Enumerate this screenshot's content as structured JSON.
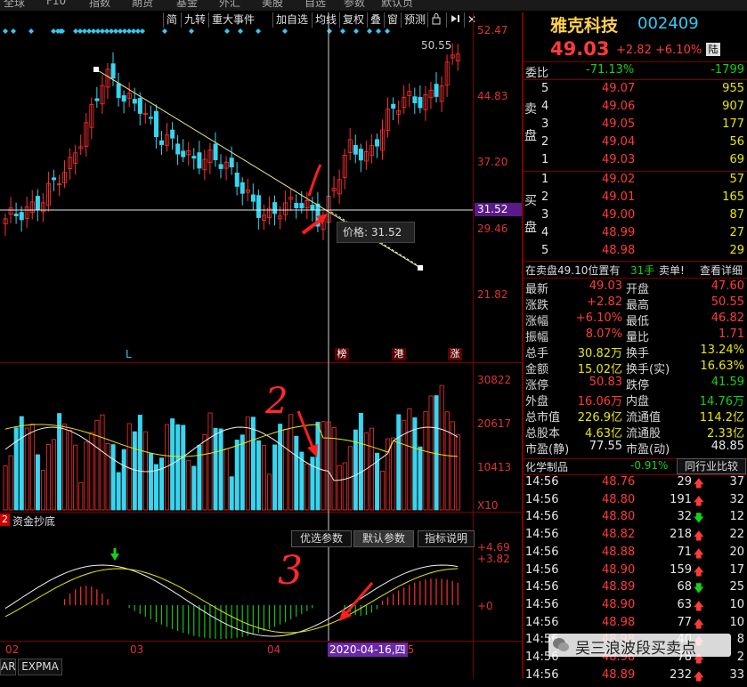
{
  "top_menu": [
    "全球",
    "F10",
    "指数",
    "期货",
    "基金",
    "外汇",
    "美股",
    "自选",
    "参数",
    "默认页"
  ],
  "toolbar": {
    "items": [
      "简",
      "九转",
      "重大事件",
      "加自选",
      "均线",
      "复权",
      "叠",
      "窗",
      "预测"
    ],
    "lock_icon": "lock-icon",
    "arrow_icon": "arrow-right-icon"
  },
  "price_axis": [
    "52.47",
    "44.83",
    "37.20",
    "31.52",
    "29.46",
    "21.82"
  ],
  "price_hover_label": "31.52",
  "price_tooltip": "价格: 31.52",
  "high_marker": "50.55",
  "event_markers": [
    "L",
    "榜",
    "港",
    "涨"
  ],
  "volume_axis": [
    "30822",
    "20617",
    "10413"
  ],
  "volume_unit": "X10",
  "volume_indicator": {
    "badge": "2",
    "name": "资金抄底"
  },
  "indicator_tabs": [
    "优选参数",
    "默认参数",
    "指标说明"
  ],
  "macd_axis": [
    "+4.69",
    "+3.82",
    "+0"
  ],
  "x_axis": [
    "02",
    "03",
    "04",
    "05"
  ],
  "cursor_date": "2020-04-16,四",
  "bottom_tabs": [
    "AR",
    "EXPMA"
  ],
  "annotations": [
    "2",
    "3"
  ],
  "stock": {
    "name": "雅克科技",
    "code": "002409",
    "price": "49.03",
    "change": "+2.82",
    "change_pct": "+6.10%",
    "tag": "陆"
  },
  "weibi": {
    "label": "委比",
    "pct": "-71.13%",
    "diff": "-1799"
  },
  "sell_label": "卖盘",
  "buy_label": "买盘",
  "asks": [
    {
      "lvl": "5",
      "price": "49.07",
      "vol": "955"
    },
    {
      "lvl": "4",
      "price": "49.06",
      "vol": "907"
    },
    {
      "lvl": "3",
      "price": "49.05",
      "vol": "177"
    },
    {
      "lvl": "2",
      "price": "49.04",
      "vol": "56"
    },
    {
      "lvl": "1",
      "price": "49.03",
      "vol": "69"
    }
  ],
  "bids": [
    {
      "lvl": "1",
      "price": "49.02",
      "vol": "57"
    },
    {
      "lvl": "2",
      "price": "49.01",
      "vol": "165"
    },
    {
      "lvl": "3",
      "price": "49.00",
      "vol": "87"
    },
    {
      "lvl": "4",
      "price": "48.99",
      "vol": "27"
    },
    {
      "lvl": "5",
      "price": "48.98",
      "vol": "29"
    }
  ],
  "sell_note": {
    "text": "在卖盘49.10位置有",
    "qty": "31手",
    "action": "卖单!",
    "link": "查看详细"
  },
  "quote": [
    {
      "l": "最新",
      "v": "49.03",
      "vc": "red",
      "l2": "开盘",
      "v2": "47.60",
      "v2c": "red"
    },
    {
      "l": "涨跌",
      "v": "+2.82",
      "vc": "red",
      "l2": "最高",
      "v2": "50.55",
      "v2c": "red"
    },
    {
      "l": "涨幅",
      "v": "+6.10%",
      "vc": "red",
      "l2": "最低",
      "v2": "46.82",
      "v2c": "red"
    },
    {
      "l": "振幅",
      "v": "8.07%",
      "vc": "red",
      "l2": "量比",
      "v2": "1.71",
      "v2c": "red"
    },
    {
      "l": "总手",
      "v": "30.82万",
      "vc": "yel",
      "l2": "换手",
      "v2": "13.24%",
      "v2c": "yel"
    },
    {
      "l": "金额",
      "v": "15.02亿",
      "vc": "yel",
      "l2": "换手(实)",
      "v2": "16.63%",
      "v2c": "yel"
    },
    {
      "l": "涨停",
      "v": "50.83",
      "vc": "red",
      "l2": "跌停",
      "v2": "41.59",
      "v2c": "grn"
    },
    {
      "l": "外盘",
      "v": "16.06万",
      "vc": "red",
      "l2": "内盘",
      "v2": "14.76万",
      "v2c": "grn"
    },
    {
      "l": "总市值",
      "v": "226.9亿",
      "vc": "yel",
      "l2": "流通值",
      "v2": "114.2亿",
      "v2c": "yel"
    },
    {
      "l": "总股本",
      "v": "4.63亿",
      "vc": "yel",
      "l2": "流通股",
      "v2": "2.33亿",
      "v2c": "yel"
    },
    {
      "l": "市盈(静)",
      "v": "77.55",
      "vc": "wht",
      "l2": "市盈(动)",
      "v2": "48.85",
      "v2c": "wht"
    }
  ],
  "industry": {
    "name": "化学制品",
    "pct": "-0.91%",
    "btn": "同行业比较"
  },
  "ticks": [
    {
      "t": "14:56",
      "p": "48.76",
      "v": "29",
      "d": "up",
      "n": "37"
    },
    {
      "t": "14:56",
      "p": "48.80",
      "v": "191",
      "d": "up",
      "n": "32"
    },
    {
      "t": "14:56",
      "p": "48.80",
      "v": "32",
      "d": "down",
      "n": "12"
    },
    {
      "t": "14:56",
      "p": "48.82",
      "v": "218",
      "d": "up",
      "n": "22"
    },
    {
      "t": "14:56",
      "p": "48.88",
      "v": "71",
      "d": "up",
      "n": "20"
    },
    {
      "t": "14:56",
      "p": "48.90",
      "v": "159",
      "d": "up",
      "n": "17"
    },
    {
      "t": "14:56",
      "p": "48.89",
      "v": "68",
      "d": "down",
      "n": "25"
    },
    {
      "t": "14:56",
      "p": "48.90",
      "v": "63",
      "d": "up",
      "n": "10"
    },
    {
      "t": "14:56",
      "p": "48.98",
      "v": "77",
      "d": "up",
      "n": "10"
    },
    {
      "t": "14:56",
      "p": "48.98",
      "v": "40",
      "d": "up",
      "n": "8"
    },
    {
      "t": "14:56",
      "p": "48.98",
      "v": "78",
      "d": "up",
      "n": "2"
    },
    {
      "t": "14:56",
      "p": "48.89",
      "v": "232",
      "d": "up",
      "n": "33"
    }
  ],
  "watermark": "吴三浪波段买卖点",
  "colors": {
    "up": "#ff3b3b",
    "down": "#18d018",
    "accent": "#37c8f0",
    "bg": "#000000"
  }
}
